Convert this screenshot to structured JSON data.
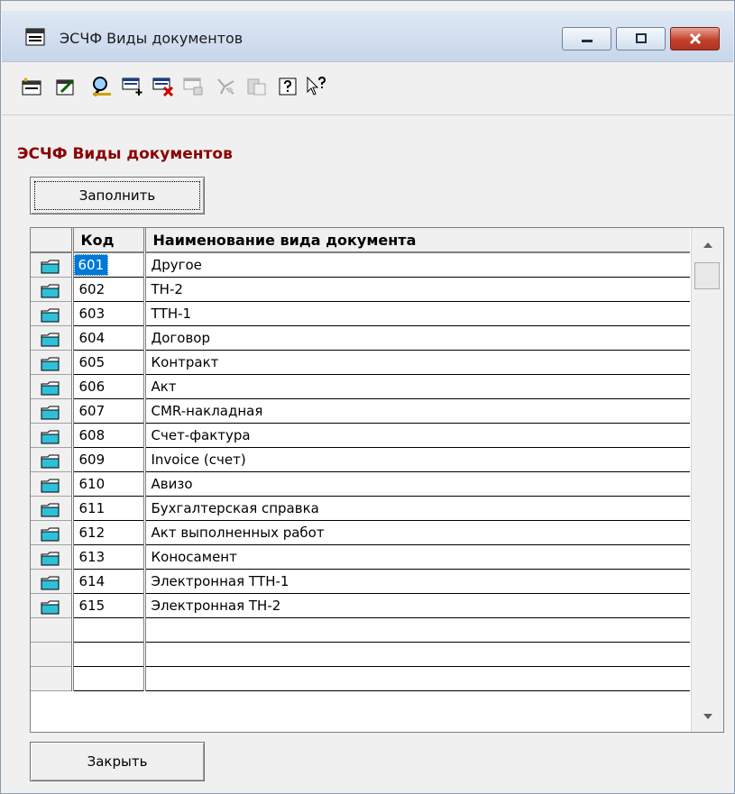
{
  "window": {
    "title": "ЭСЧФ Виды документов"
  },
  "toolbar": {
    "icons": [
      "new-record-icon",
      "edit-record-icon",
      "find-icon",
      "add-row-icon",
      "delete-row-icon",
      "copy-record-icon",
      "filter-icon",
      "paste-icon",
      "help-icon",
      "context-help-icon"
    ]
  },
  "panel": {
    "title": "ЭСЧФ Виды документов",
    "fill_label": "Заполнить",
    "close_label": "Закрыть"
  },
  "grid": {
    "columns": [
      "Код",
      "Наименование вида документа"
    ],
    "rows": [
      {
        "code": "601",
        "name": "Другое"
      },
      {
        "code": "602",
        "name": "ТН-2"
      },
      {
        "code": "603",
        "name": "ТТН-1"
      },
      {
        "code": "604",
        "name": "Договор"
      },
      {
        "code": "605",
        "name": "Контракт"
      },
      {
        "code": "606",
        "name": "Акт"
      },
      {
        "code": "607",
        "name": "CMR-накладная"
      },
      {
        "code": "608",
        "name": "Счет-фактура"
      },
      {
        "code": "609",
        "name": "Invoice (счет)"
      },
      {
        "code": "610",
        "name": "Авизо"
      },
      {
        "code": "611",
        "name": "Бухгалтерская справка"
      },
      {
        "code": "612",
        "name": "Акт выполненных работ"
      },
      {
        "code": "613",
        "name": "Коносамент"
      },
      {
        "code": "614",
        "name": "Электронная ТТН-1"
      },
      {
        "code": "615",
        "name": "Электронная ТН-2"
      }
    ],
    "selected_code": "601",
    "empty_rows": 3
  },
  "colors": {
    "panel_title": "#8b0000",
    "selection": "#0078d7",
    "close_button": "#c2412c"
  }
}
